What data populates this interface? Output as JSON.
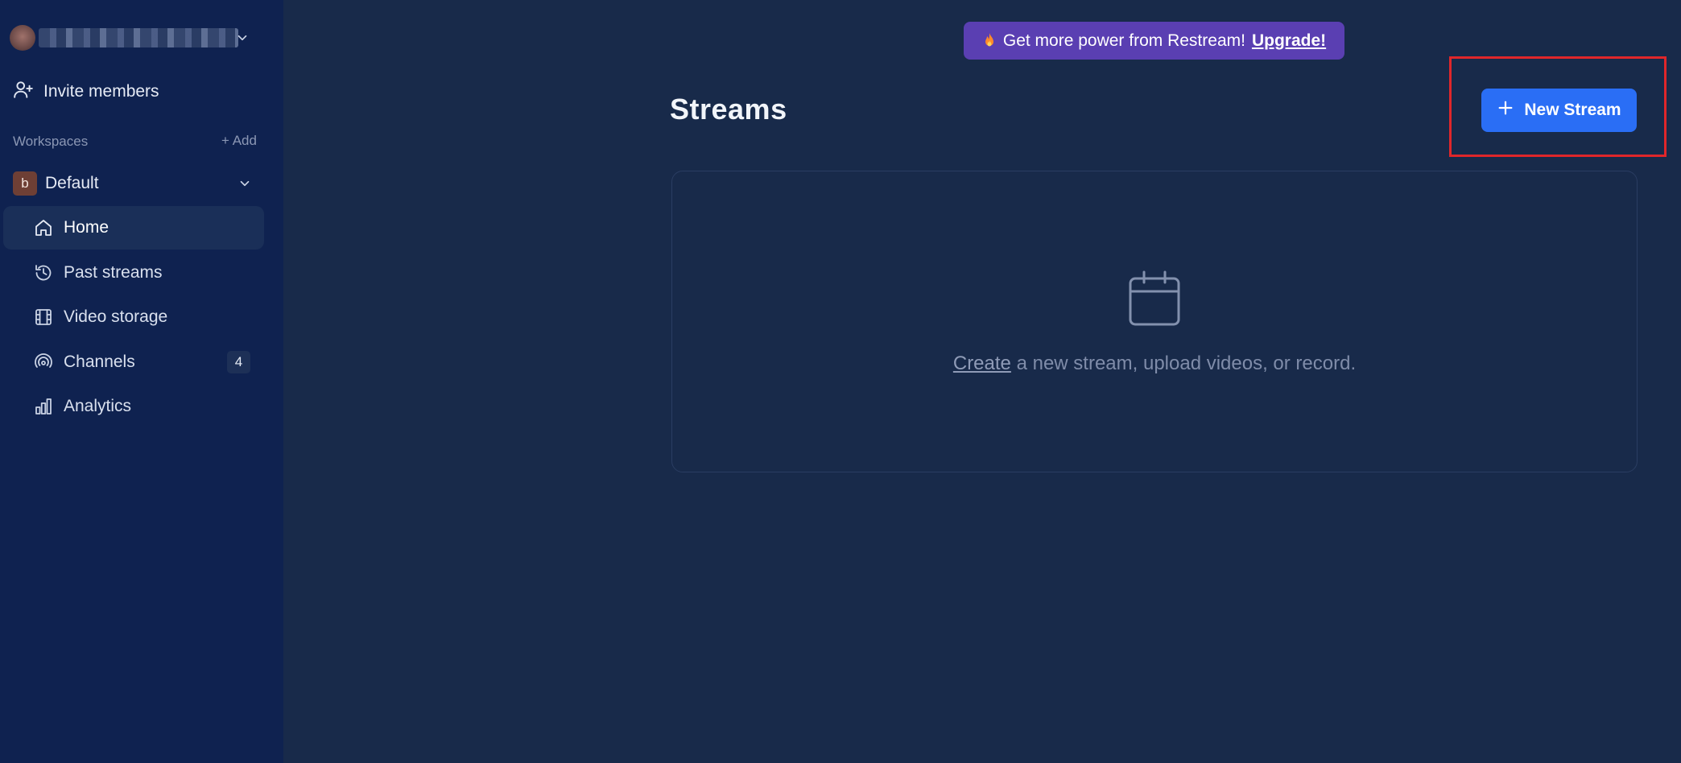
{
  "sidebar": {
    "account": {
      "avatar_icon": "user-avatar",
      "menu_icon": "chevron-down-icon"
    },
    "invite_label": "Invite members",
    "workspaces_label": "Workspaces",
    "add_label": "+ Add",
    "workspace": {
      "badge": "b",
      "name": "Default"
    },
    "nav": [
      {
        "label": "Home",
        "icon": "home-icon",
        "active": true
      },
      {
        "label": "Past streams",
        "icon": "clock-icon"
      },
      {
        "label": "Video storage",
        "icon": "film-icon"
      },
      {
        "label": "Channels",
        "icon": "broadcast-icon",
        "count": "4"
      },
      {
        "label": "Analytics",
        "icon": "bar-chart-icon"
      }
    ]
  },
  "promo": {
    "text": "Get more power from Restream!",
    "link": "Upgrade!"
  },
  "main": {
    "title": "Streams",
    "new_stream_label": "New Stream",
    "empty_state": {
      "link": "Create",
      "text": " a new stream, upload videos, or record."
    }
  },
  "colors": {
    "sidebar_bg": "#0f2250",
    "main_bg": "#182a4a",
    "primary_button": "#2a6ef5",
    "promo_bg": "#5a3fb2",
    "highlight": "#e0262a"
  }
}
